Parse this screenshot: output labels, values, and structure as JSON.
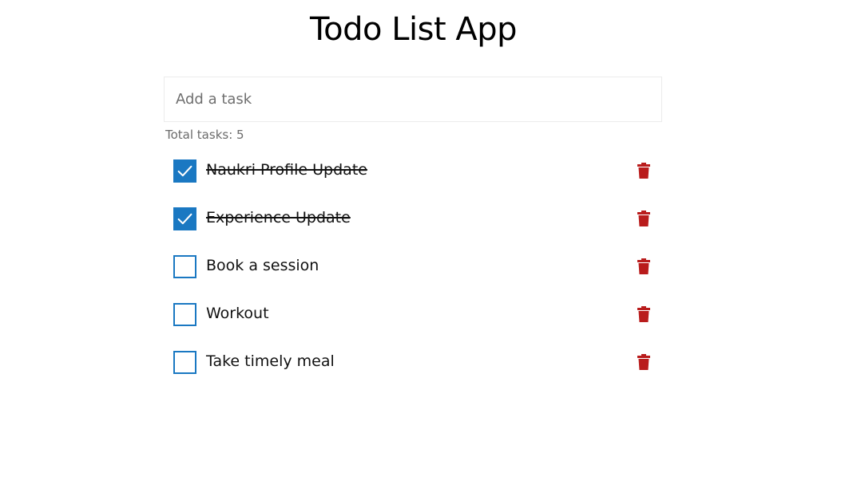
{
  "app": {
    "title": "Todo List App"
  },
  "input": {
    "placeholder": "Add a task",
    "value": ""
  },
  "summary": {
    "total_label": "Total tasks: 5"
  },
  "colors": {
    "checkbox": "#1a78c2",
    "delete_icon": "#b91c1c"
  },
  "tasks": [
    {
      "label": "Naukri Profile Update",
      "done": true
    },
    {
      "label": "Experience Update",
      "done": true
    },
    {
      "label": "Book a session",
      "done": false
    },
    {
      "label": "Workout",
      "done": false
    },
    {
      "label": "Take timely meal",
      "done": false
    }
  ],
  "icons": {
    "check": "check-icon",
    "delete": "trash-icon"
  }
}
